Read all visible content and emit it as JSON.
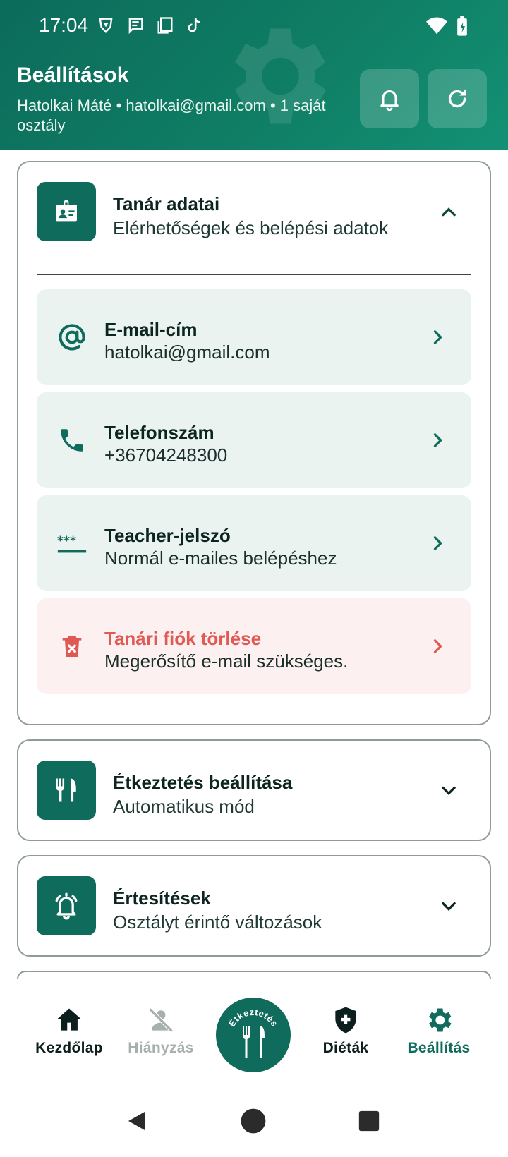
{
  "status_bar": {
    "time": "17:04"
  },
  "header": {
    "title": "Beállítások",
    "subtitle": "Hatolkai Máté • hatolkai@gmail.com • 1 saját osztály",
    "bell_icon": "bell-icon",
    "refresh_icon": "refresh-icon"
  },
  "teacher_card": {
    "title": "Tanár adatai",
    "subtitle": "Elérhetőségek és belépési adatok",
    "rows": [
      {
        "title": "E-mail-cím",
        "value": "hatolkai@gmail.com",
        "icon": "at-icon"
      },
      {
        "title": "Telefonszám",
        "value": "+36704248300",
        "icon": "phone-icon"
      },
      {
        "title": "Teacher-jelszó",
        "value": "Normál e-mailes belépéshez",
        "icon": "password-icon"
      },
      {
        "title": "Tanári fiók törlése",
        "value": "Megerősítő e-mail szükséges.",
        "icon": "delete-icon"
      }
    ]
  },
  "meal_card": {
    "title": "Étkeztetés beállítása",
    "subtitle": "Automatikus mód"
  },
  "notify_card": {
    "title": "Értesítések",
    "subtitle": "Osztályt érintő változások"
  },
  "bottom_nav": {
    "items": [
      {
        "label": "Kezdőlap"
      },
      {
        "label": "Hiányzás"
      },
      {
        "label": "Diéták"
      },
      {
        "label": "Beállítás"
      }
    ],
    "center_label": "Étkeztetés"
  },
  "colors": {
    "primary": "#0f6b5c",
    "danger": "#e05a55",
    "row_bg": "#eaf3f0"
  }
}
